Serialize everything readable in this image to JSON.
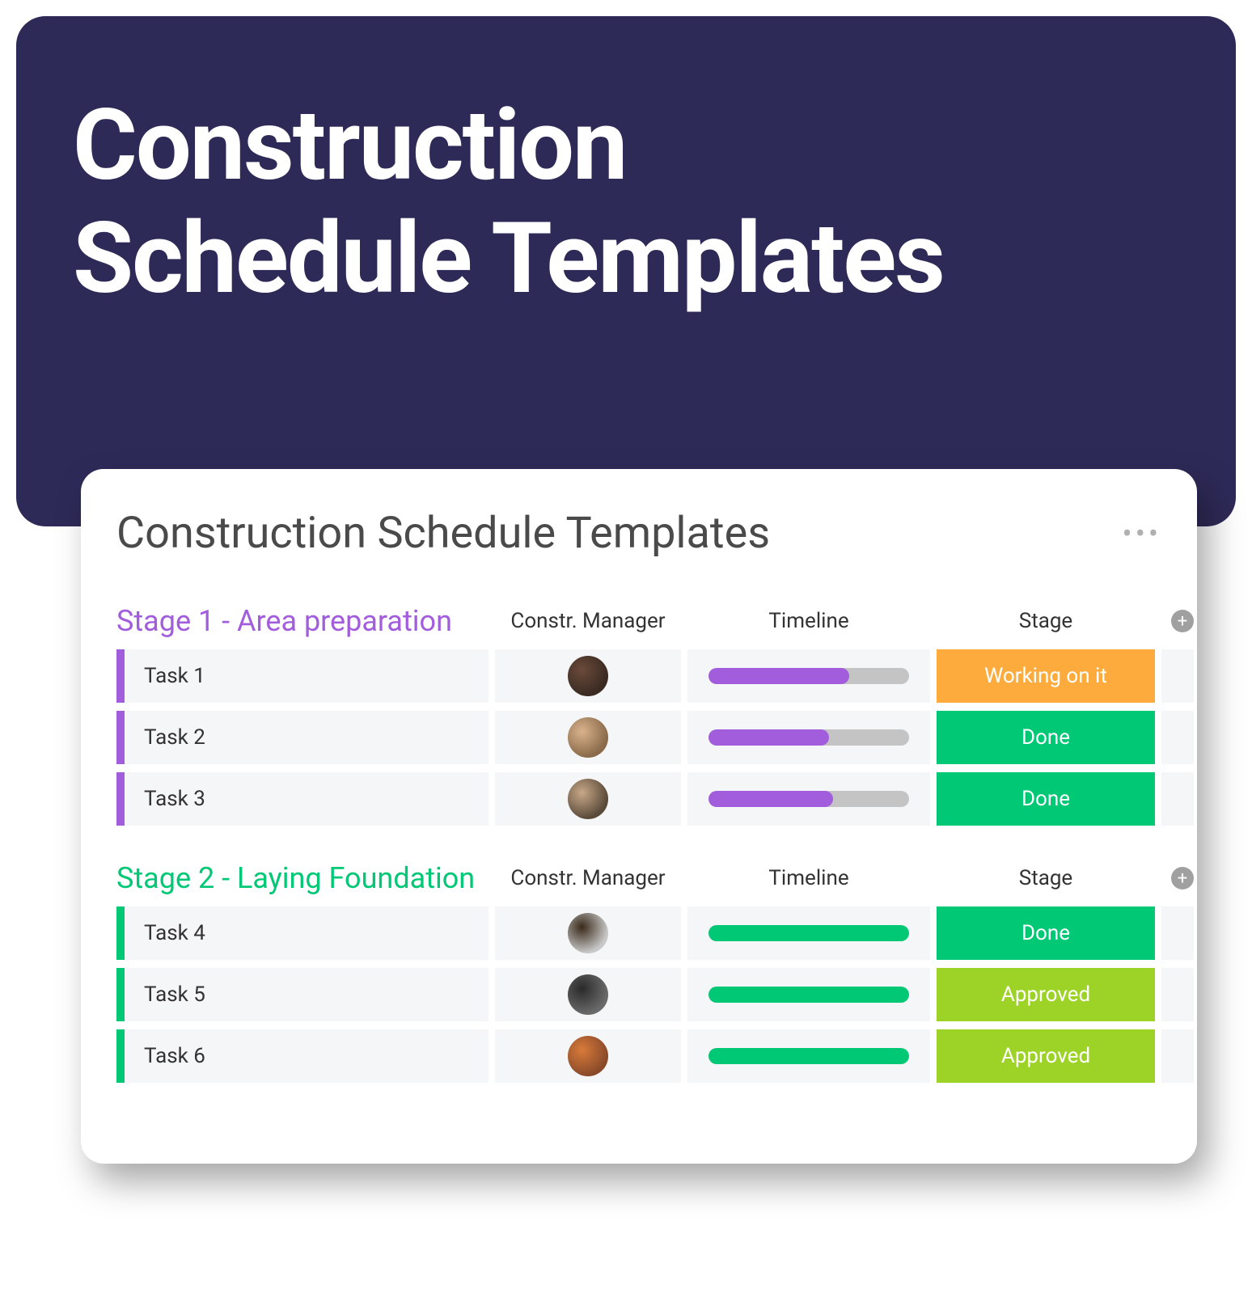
{
  "hero": {
    "title_line1": "Construction",
    "title_line2": "Schedule Templates"
  },
  "card": {
    "title": "Construction Schedule Templates",
    "columns": {
      "manager": "Constr. Manager",
      "timeline": "Timeline",
      "stage": "Stage"
    },
    "groups": [
      {
        "title": "Stage 1 - Area preparation",
        "colorClass": "purple",
        "tasks": [
          {
            "name": "Task 1",
            "avatarColors": [
              "#6a4a3a",
              "#3a2a22"
            ],
            "timelinePercent": 70,
            "stageLabel": "Working on it",
            "stageClass": "stage-orange"
          },
          {
            "name": "Task 2",
            "avatarColors": [
              "#d9b28c",
              "#8a6a4a"
            ],
            "timelinePercent": 60,
            "stageLabel": "Done",
            "stageClass": "stage-green"
          },
          {
            "name": "Task 3",
            "avatarColors": [
              "#c8a888",
              "#5a4a3a"
            ],
            "timelinePercent": 62,
            "stageLabel": "Done",
            "stageClass": "stage-green"
          }
        ]
      },
      {
        "title": "Stage 2 - Laying Foundation",
        "colorClass": "green",
        "tasks": [
          {
            "name": "Task 4",
            "avatarColors": [
              "#3a2a1a",
              "#c8c8c8"
            ],
            "timelinePercent": 100,
            "stageLabel": "Done",
            "stageClass": "stage-green"
          },
          {
            "name": "Task 5",
            "avatarColors": [
              "#2a2a2a",
              "#6a6a6a"
            ],
            "timelinePercent": 100,
            "stageLabel": "Approved",
            "stageClass": "stage-lightgreen"
          },
          {
            "name": "Task 6",
            "avatarColors": [
              "#d87a3a",
              "#8a4a2a"
            ],
            "timelinePercent": 100,
            "stageLabel": "Approved",
            "stageClass": "stage-lightgreen"
          }
        ]
      }
    ]
  }
}
